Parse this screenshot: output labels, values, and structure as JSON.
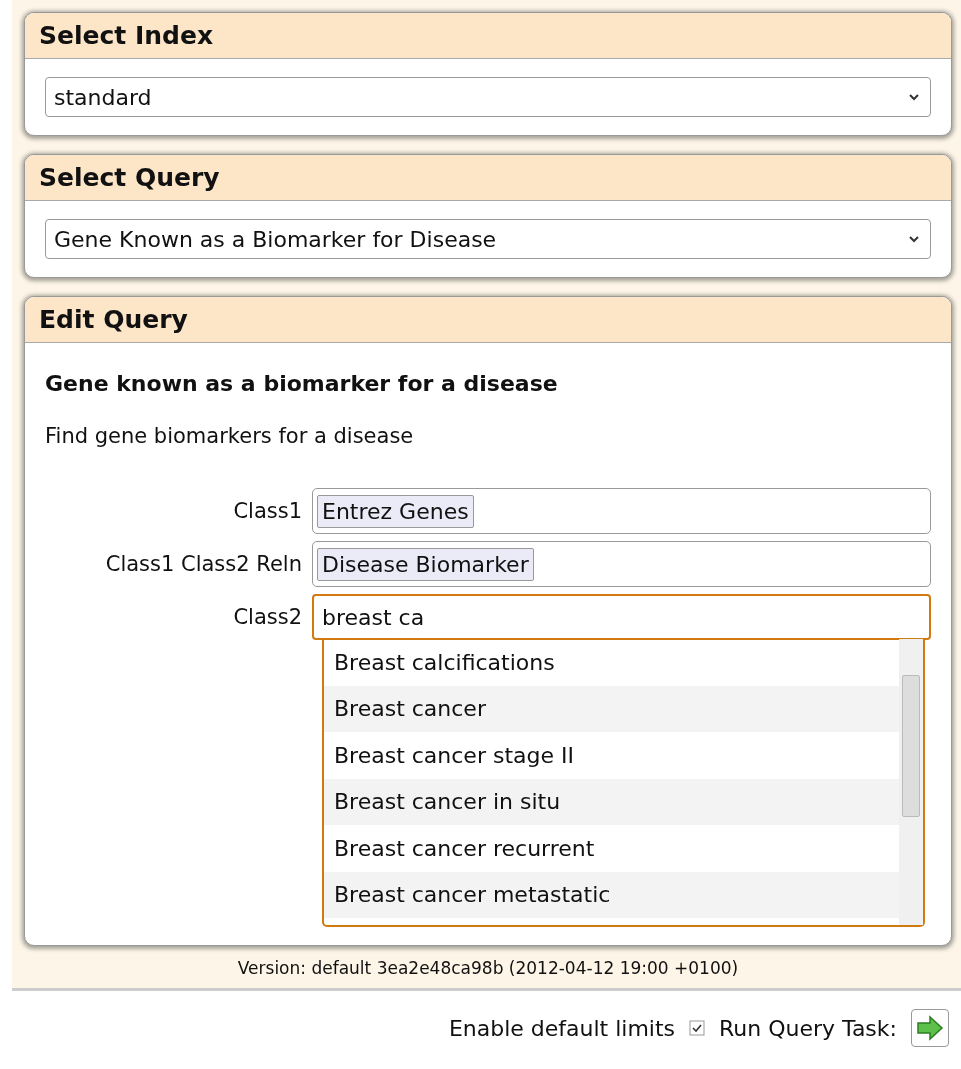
{
  "panels": [
    {
      "title": "Select Index",
      "kind": "select",
      "value": "standard"
    },
    {
      "title": "Select Query",
      "kind": "select",
      "value": "Gene Known as a Biomarker for Disease"
    },
    {
      "title": "Edit Query",
      "kind": "editor",
      "heading": "Gene known as a biomarker for a disease",
      "description": "Find gene biomarkers for a disease",
      "fields": [
        {
          "label": "Class1",
          "kind": "token",
          "value": "Entrez Genes",
          "focused": false
        },
        {
          "label": "Class1 Class2 Reln",
          "kind": "token",
          "value": "Disease Biomarker",
          "focused": false
        },
        {
          "label": "Class2",
          "kind": "text",
          "value": "breast ca",
          "focused": true
        }
      ],
      "suggestions": [
        "Breast calcifications",
        "Breast cancer",
        "Breast cancer stage II",
        "Breast cancer in situ",
        "Breast cancer recurrent",
        "Breast cancer metastatic"
      ]
    }
  ],
  "version": "Version: default 3ea2e48ca98b (2012-04-12 19:00 +0100)",
  "limits": {
    "label": "Enable default limits",
    "checked": true
  },
  "run": {
    "label": "Run Query Task:"
  }
}
